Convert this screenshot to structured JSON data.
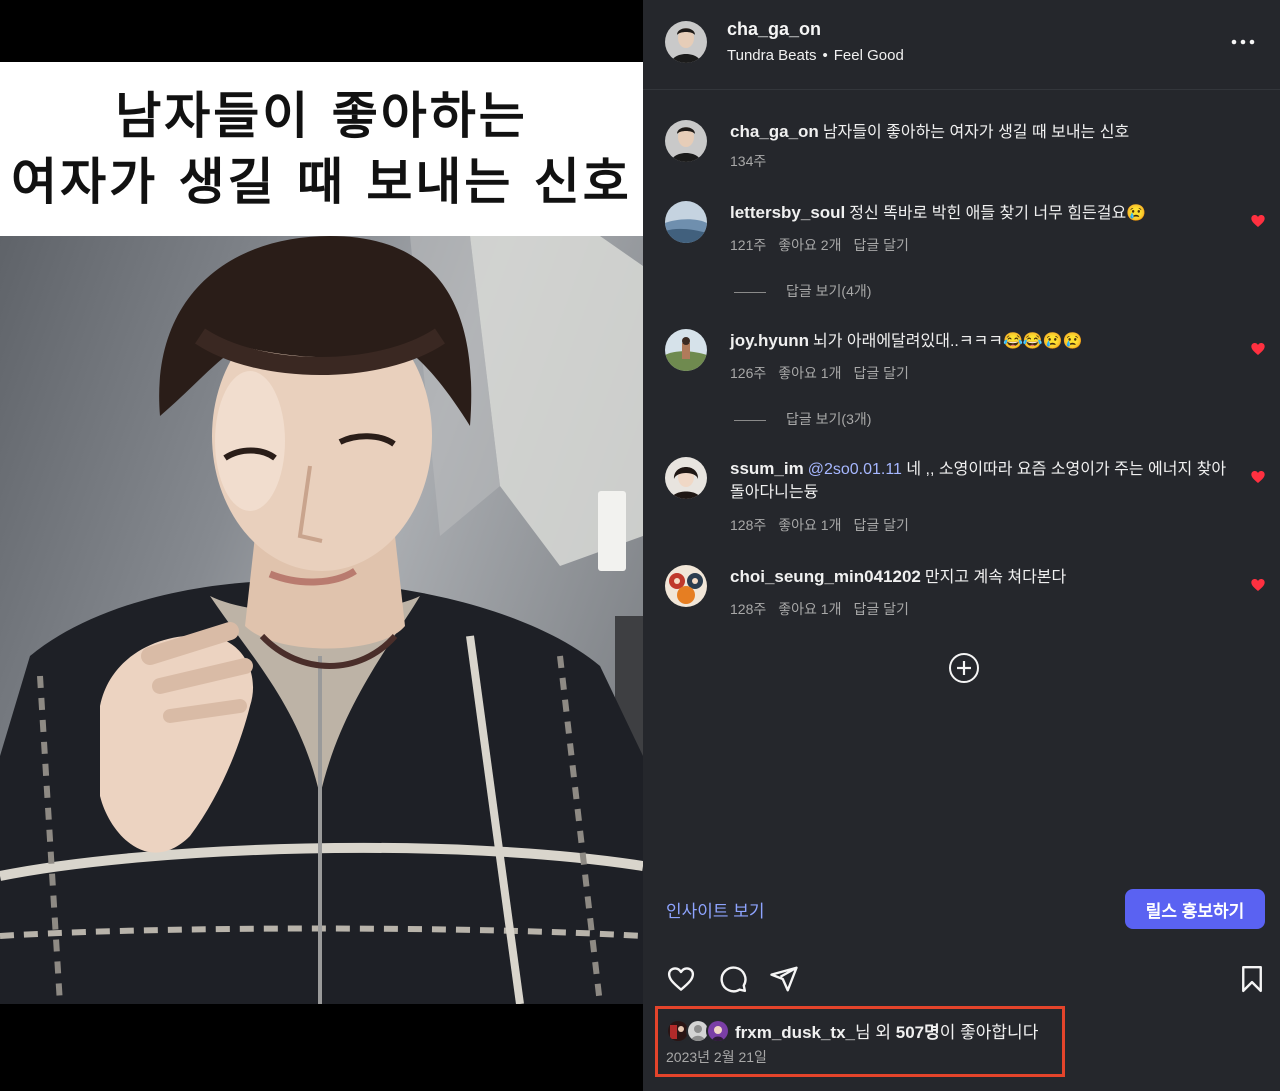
{
  "reel": {
    "caption_line1": "남자들이 좋아하는",
    "caption_line2": "여자가 생길 때 보내는 신호"
  },
  "header": {
    "username": "cha_ga_on",
    "audio_artist": "Tundra Beats",
    "audio_separator": "•",
    "audio_title": "Feel Good",
    "more_icon": "more-horizontal-icon"
  },
  "post_caption": {
    "username": "cha_ga_on",
    "text": "남자들이 좋아하는 여자가 생길 때 보내는 신호",
    "time": "134주"
  },
  "comments": [
    {
      "username": "lettersby_soul",
      "text": "정신 똑바로 박힌 애들 찾기 너무 힘든걸요😢",
      "time": "121주",
      "likes": "좋아요 2개",
      "reply": "답글 달기",
      "view_replies": "답글 보기(4개)"
    },
    {
      "username": "joy.hyunn",
      "text": "뇌가 아래에달려있대..ㅋㅋㅋ😂😂😢😢",
      "time": "126주",
      "likes": "좋아요 1개",
      "reply": "답글 달기",
      "view_replies": "답글 보기(3개)"
    },
    {
      "username": "ssum_im",
      "mention": "@2so0.01.11",
      "text": "네 ,, 소영이따라 요즘 소영이가 주는 에너지 찾아 돌아다니는듕",
      "time": "128주",
      "likes": "좋아요 1개",
      "reply": "답글 달기"
    },
    {
      "username": "choi_seung_min041202",
      "text": "만지고 계속 쳐다본다",
      "time": "128주",
      "likes": "좋아요 1개",
      "reply": "답글 달기"
    }
  ],
  "actions": {
    "insights_label": "인사이트 보기",
    "promote_label": "릴스 홍보하기",
    "icons": [
      "heart-icon",
      "comment-icon",
      "share-icon",
      "bookmark-icon"
    ]
  },
  "likes": {
    "first_user": "frxm_dusk_tx_",
    "suffix_1": "님 외 ",
    "count": "507명",
    "suffix_2": "이 좋아합니다",
    "date": "2023년 2월 21일"
  },
  "colors": {
    "panel_bg": "#25272c",
    "accent_button": "#5a62f2",
    "link": "#8ea4ff",
    "liked_heart": "#ff3040",
    "highlight_box": "#e4442b"
  }
}
